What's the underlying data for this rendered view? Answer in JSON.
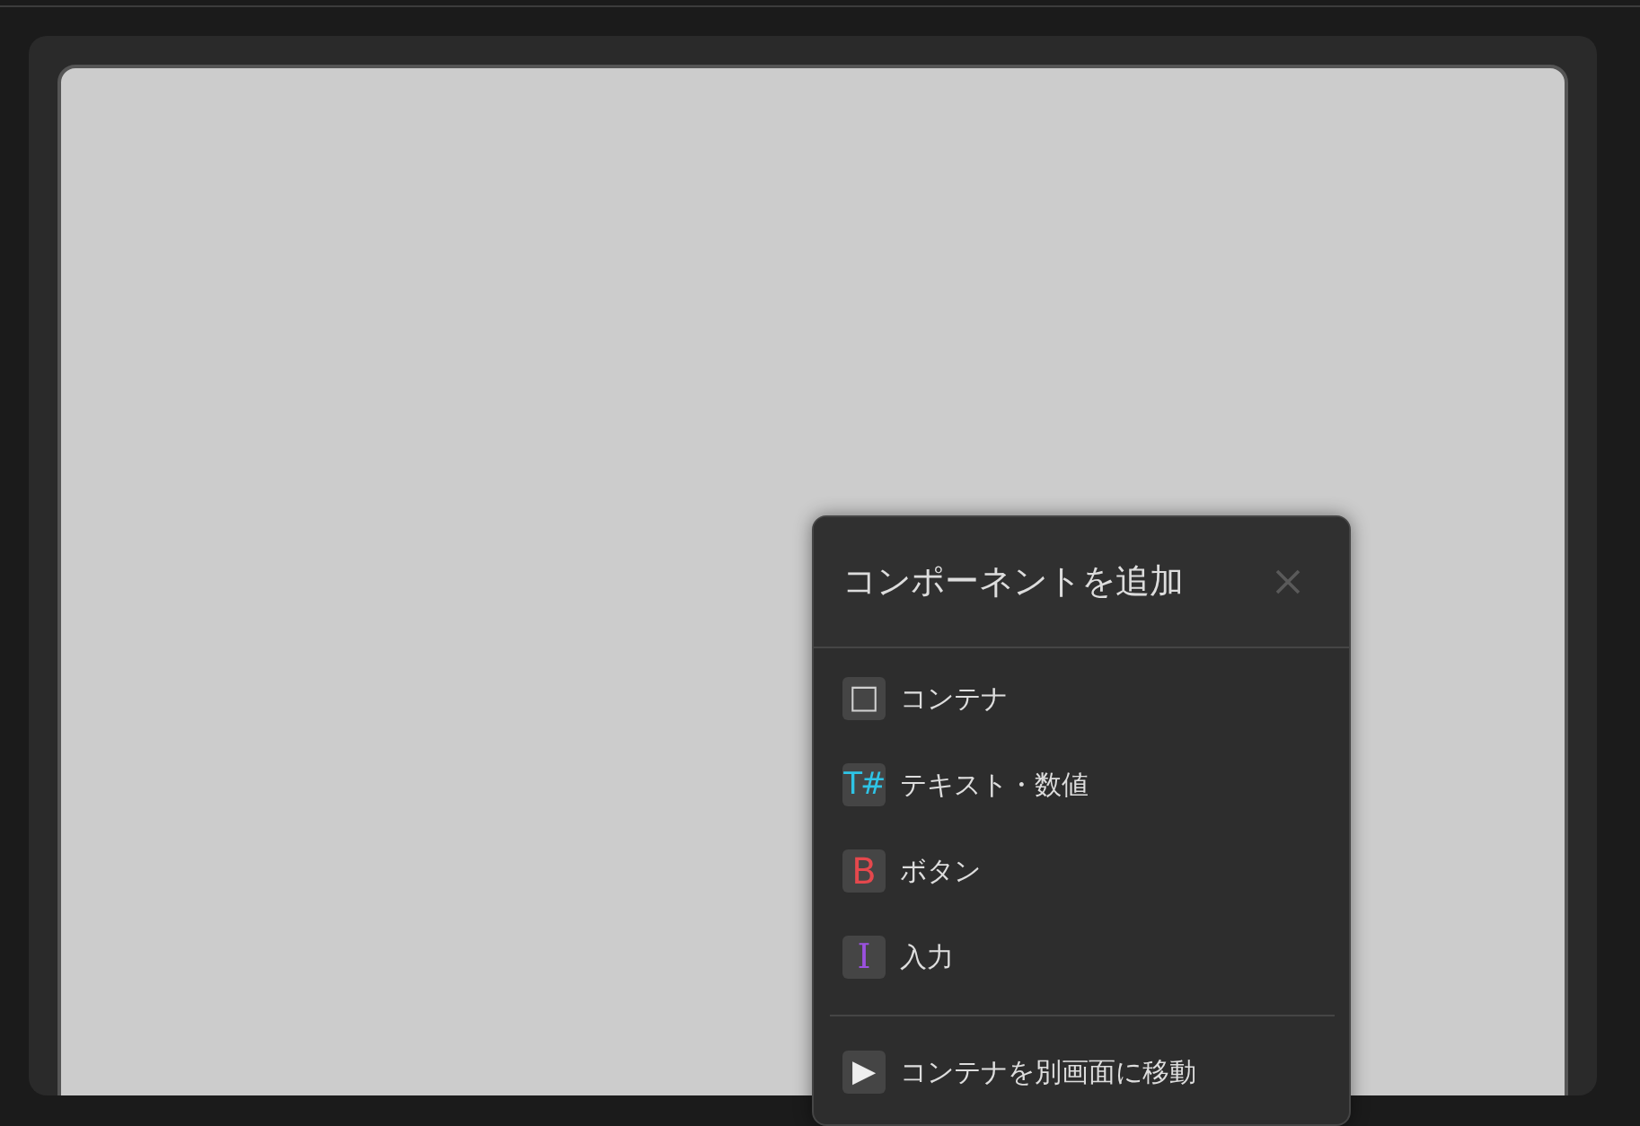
{
  "header": {
    "title": "コンポーネントを追加"
  },
  "sections": [
    {
      "items": [
        {
          "kind": "container",
          "icon": "□",
          "color": "#d0d0d0",
          "label": "コンテナ"
        },
        {
          "kind": "text",
          "icon": "T#",
          "color": "#2ec4e6",
          "label": "テキスト・数値"
        },
        {
          "kind": "button",
          "icon": "B",
          "color": "#e5484d",
          "label": "ボタン"
        },
        {
          "kind": "input",
          "icon": "I",
          "color": "#9b51e0",
          "label": "入力"
        }
      ]
    },
    {
      "items": [
        {
          "kind": "move",
          "icon": "▶",
          "color": "#eeeeee",
          "label": "コンテナを別画面に移動"
        }
      ]
    }
  ]
}
